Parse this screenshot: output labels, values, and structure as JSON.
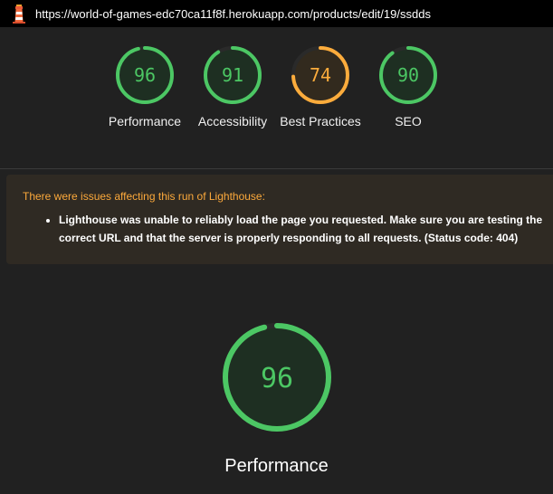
{
  "browser": {
    "url": "https://world-of-games-edc70ca11f8f.herokuapp.com/products/edit/19/ssdds"
  },
  "colors": {
    "pass": "#4cc764",
    "average": "#fcac3c",
    "pass_bg": "#1e2f22",
    "average_bg": "#322a1e",
    "track": "#2a2a2a"
  },
  "gauges": [
    {
      "label": "Performance",
      "score": "96",
      "rating": "pass"
    },
    {
      "label": "Accessibility",
      "score": "91",
      "rating": "pass"
    },
    {
      "label": "Best Practices",
      "score": "74",
      "rating": "average"
    },
    {
      "label": "SEO",
      "score": "90",
      "rating": "pass"
    }
  ],
  "warning": {
    "title": "There were issues affecting this run of Lighthouse:",
    "items": [
      "Lighthouse was unable to reliably load the page you requested. Make sure you are testing the correct URL and that the server is properly responding to all requests. (Status code: 404)"
    ]
  },
  "main_gauge": {
    "label": "Performance",
    "score": "96",
    "rating": "pass"
  }
}
